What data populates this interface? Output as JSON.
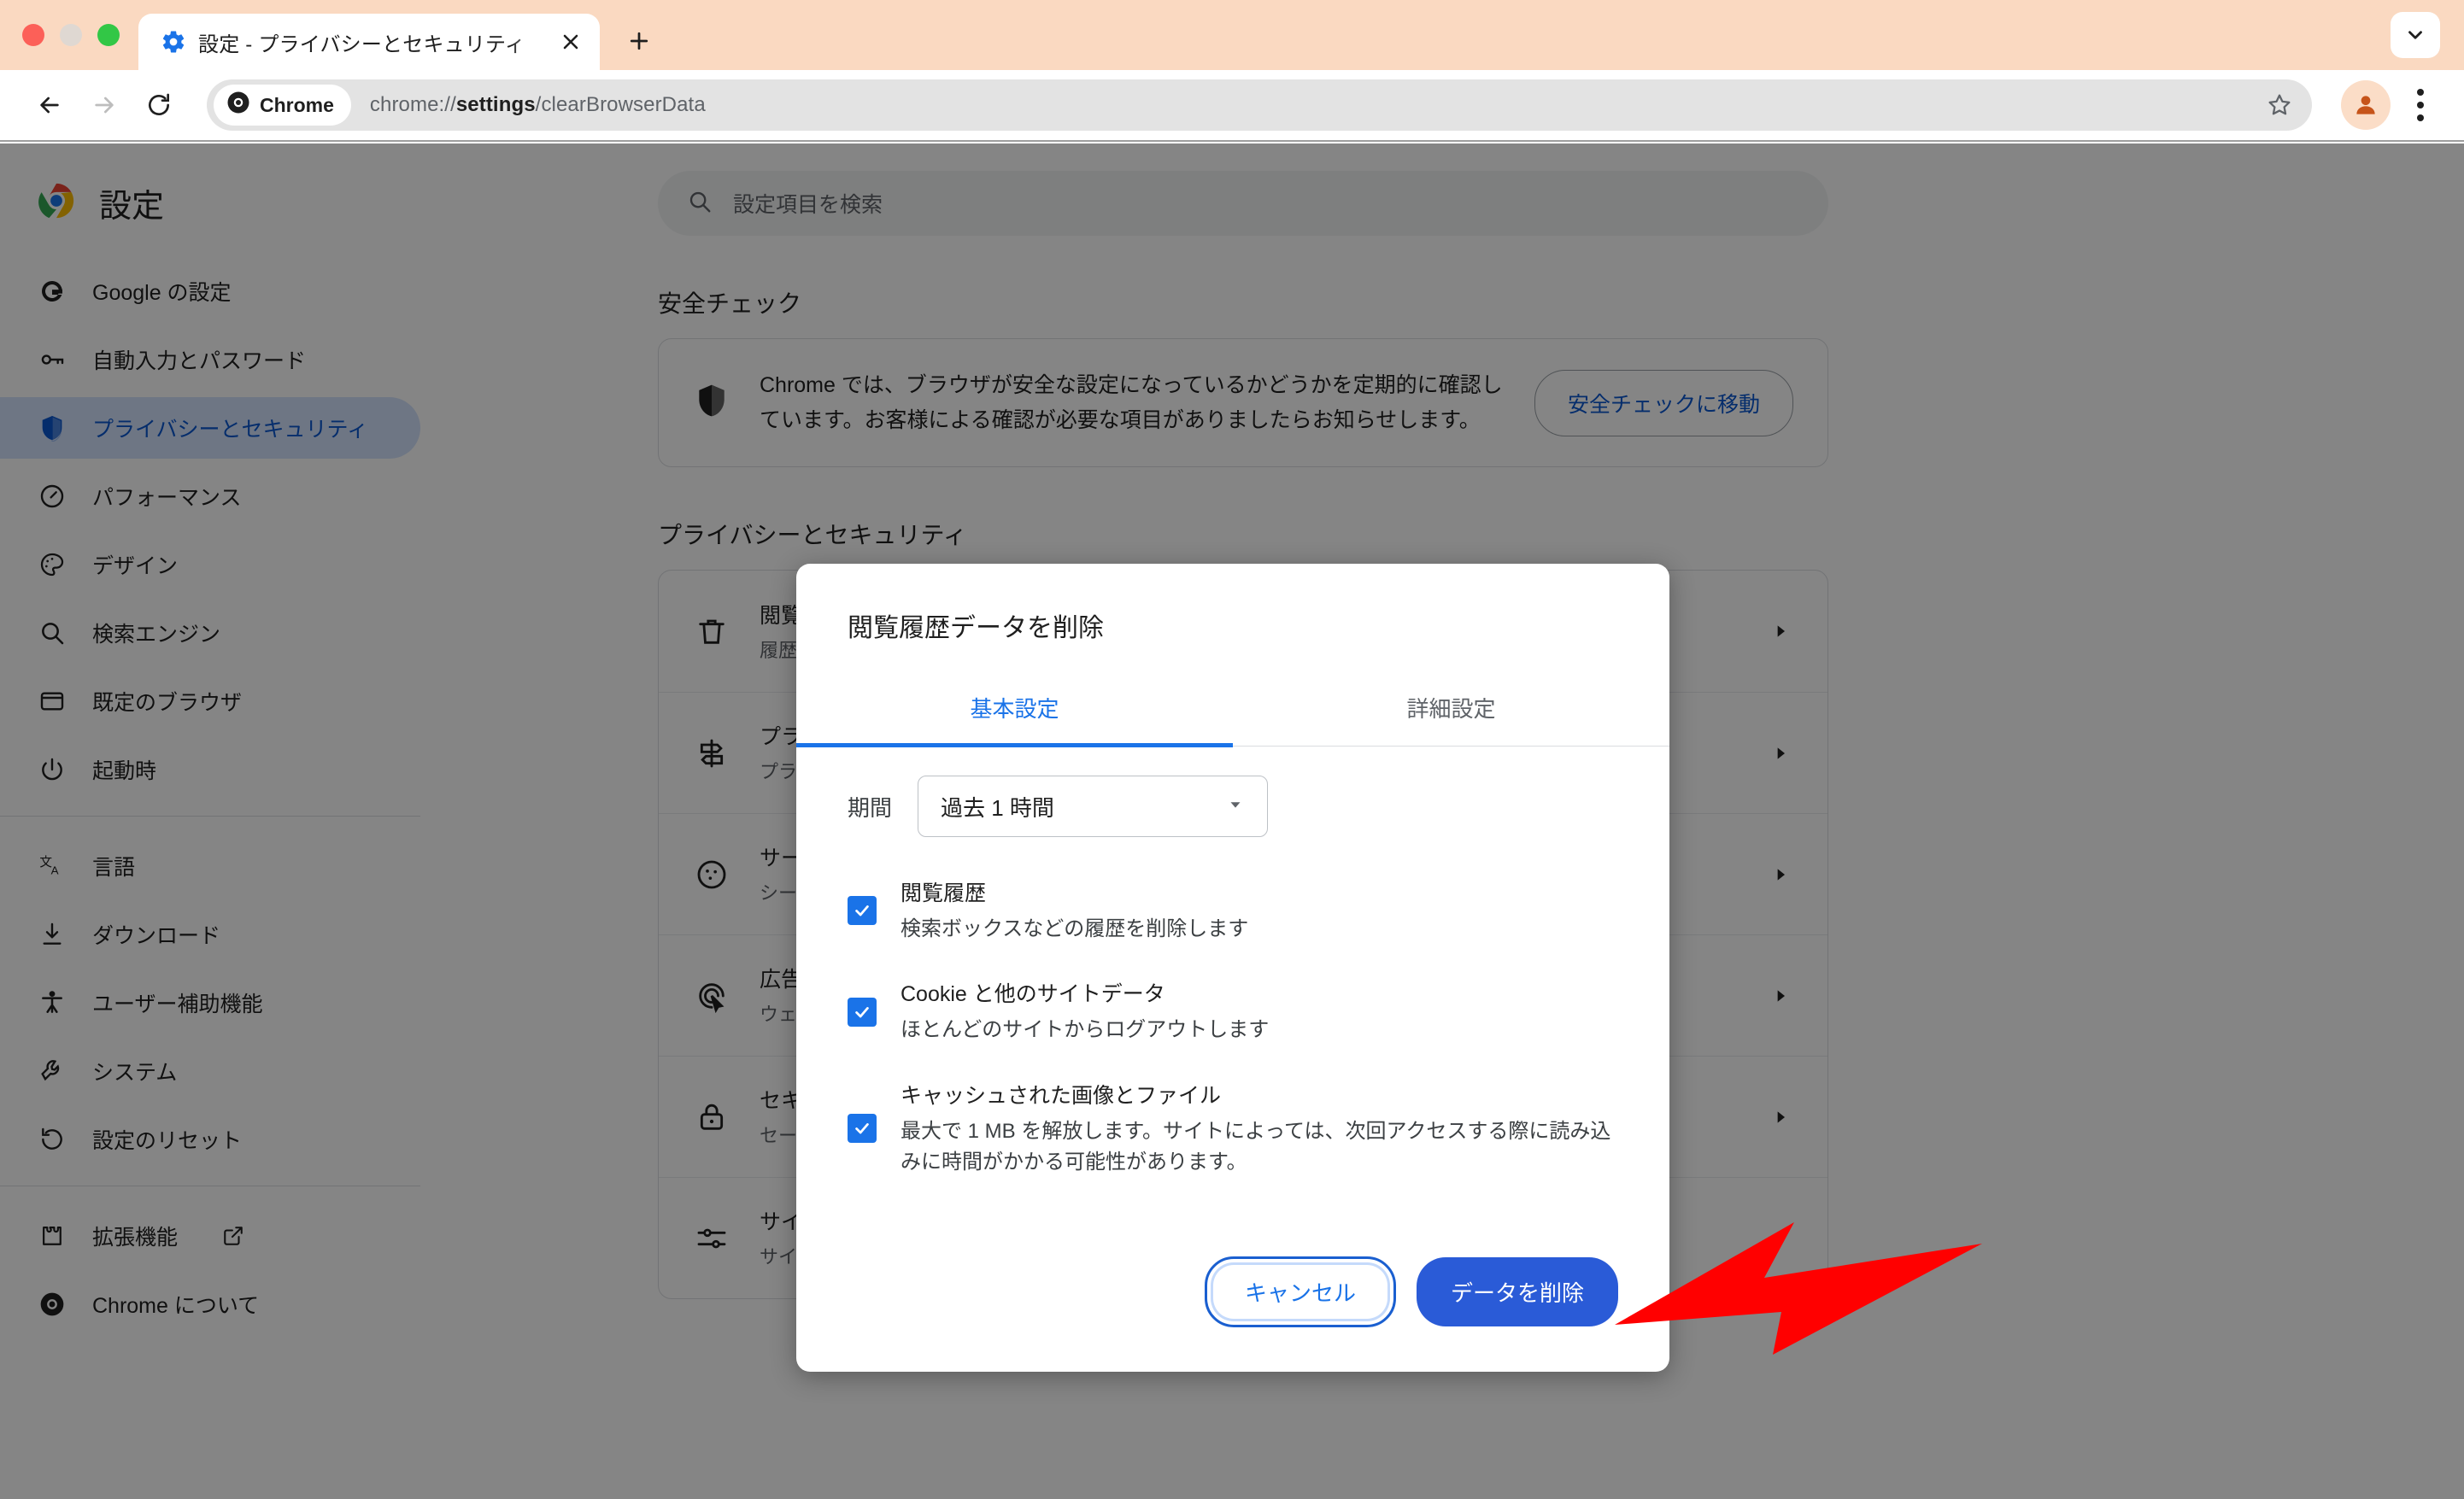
{
  "browser": {
    "tab": {
      "title": "設定 - プライバシーとセキュリティ",
      "favicon_icon": "gear-icon",
      "close_icon": "close-icon"
    },
    "new_tab_icon": "plus-icon",
    "tabstrip_chevron_icon": "chevron-down-icon",
    "back_icon": "arrow-left-icon",
    "forward_icon": "arrow-right-icon",
    "reload_icon": "reload-icon",
    "omnibox": {
      "chip_label": "Chrome",
      "chip_icon": "chrome-icon",
      "url_prefix": "chrome://",
      "url_bold": "settings",
      "url_suffix": "/clearBrowserData",
      "url_full": "chrome://settings/clearBrowserData",
      "star_icon": "star-icon"
    },
    "avatar_icon": "person-icon",
    "menu_icon": "kebab-menu-icon"
  },
  "sidebar": {
    "brand": {
      "label": "設定",
      "icon": "chrome-logo-icon"
    },
    "group1": [
      {
        "label": "Google の設定",
        "icon": "google-g-icon",
        "active": false
      },
      {
        "label": "自動入力とパスワード",
        "icon": "key-icon",
        "active": false
      },
      {
        "label": "プライバシーとセキュリティ",
        "icon": "shield-icon",
        "active": true
      },
      {
        "label": "パフォーマンス",
        "icon": "speedometer-icon",
        "active": false
      },
      {
        "label": "デザイン",
        "icon": "palette-icon",
        "active": false
      },
      {
        "label": "検索エンジン",
        "icon": "search-icon",
        "active": false
      },
      {
        "label": "既定のブラウザ",
        "icon": "window-icon",
        "active": false
      },
      {
        "label": "起動時",
        "icon": "power-icon",
        "active": false
      }
    ],
    "group2": [
      {
        "label": "言語",
        "icon": "translate-icon",
        "active": false
      },
      {
        "label": "ダウンロード",
        "icon": "download-icon",
        "active": false
      },
      {
        "label": "ユーザー補助機能",
        "icon": "accessibility-icon",
        "active": false
      },
      {
        "label": "システム",
        "icon": "wrench-icon",
        "active": false
      },
      {
        "label": "設定のリセット",
        "icon": "restore-icon",
        "active": false
      }
    ],
    "group3": [
      {
        "label": "拡張機能",
        "icon": "puzzle-icon",
        "external_icon": "open-in-new-icon",
        "active": false
      },
      {
        "label": "Chrome について",
        "icon": "chrome-icon",
        "active": false
      }
    ]
  },
  "main": {
    "search": {
      "placeholder": "設定項目を検索",
      "icon": "search-icon"
    },
    "safety_section_title": "安全チェック",
    "safety_card": {
      "icon": "shield-icon",
      "text": "Chrome では、ブラウザが安全な設定になっているかどうかを定期的に確認しています。お客様による確認が必要な項目がありましたらお知らせします。",
      "button_label": "安全チェックに移動"
    },
    "privacy_section_title": "プライバシーとセキュリティ",
    "privacy_rows": [
      {
        "icon": "trash-icon",
        "title": "閲覧履歴データを削除",
        "sub": "履歴、Cookie、キャッシュなどを削除します",
        "arrow_icon": "chevron-right-icon"
      },
      {
        "icon": "signpost-icon",
        "title": "プライバシー ガイド",
        "sub": "プライバシーとセキュリティに関する主な管理機能を確認",
        "arrow_icon": "chevron-right-icon"
      },
      {
        "icon": "cookie-icon",
        "title": "サードパーティ Cookie",
        "sub": "シークレット モードでサードパーティ Cookie がブロックされています",
        "arrow_icon": "chevron-right-icon"
      },
      {
        "icon": "ad-target-icon",
        "title": "広告プライバシー",
        "sub": "ウェブサイトが広告を表示するために使用する情報をカスタマイズします",
        "arrow_icon": "chevron-right-icon"
      },
      {
        "icon": "lock-icon",
        "title": "セキュリティ",
        "sub": "セーフ ブラウジング（危険なサイトからの保護）などのセキュリティ設定",
        "arrow_icon": "chevron-right-icon"
      },
      {
        "icon": "tune-icon",
        "title": "サイトの設定",
        "sub": "サイトが使用、表示できる情報（位置情報、カメラ、ポップアップなど）を制御します",
        "arrow_icon": "chevron-right-icon"
      }
    ]
  },
  "dialog": {
    "title": "閲覧履歴データを削除",
    "tabs": [
      {
        "label": "基本設定",
        "active": true
      },
      {
        "label": "詳細設定",
        "active": false
      }
    ],
    "period": {
      "label": "期間",
      "value": "過去 1 時間",
      "caret_icon": "chevron-down-icon"
    },
    "checkboxes": [
      {
        "checked": true,
        "check_icon": "check-icon",
        "title": "閲覧履歴",
        "sub": "検索ボックスなどの履歴を削除します"
      },
      {
        "checked": true,
        "check_icon": "check-icon",
        "title": "Cookie と他のサイトデータ",
        "sub": "ほとんどのサイトからログアウトします"
      },
      {
        "checked": true,
        "check_icon": "check-icon",
        "title": "キャッシュされた画像とファイル",
        "sub": "最大で 1 MB を解放します。サイトによっては、次回アクセスする際に読み込みに時間がかかる可能性があります。"
      }
    ],
    "cancel_label": "キャンセル",
    "delete_label": "データを削除"
  },
  "annotation": {
    "arrow_icon": "pointer-arrow-icon",
    "color": "#ff0000",
    "points_at": "データを削除"
  },
  "colors": {
    "tabstrip_bg": "#fad9c1",
    "accent_blue": "#1a73e8",
    "primary_button": "#2a5bd7",
    "active_nav_bg": "#d3e3fd",
    "active_nav_text": "#0b57d0",
    "scrim": "rgba(0,0,0,0.48)",
    "annotation_red": "#ff0000"
  }
}
